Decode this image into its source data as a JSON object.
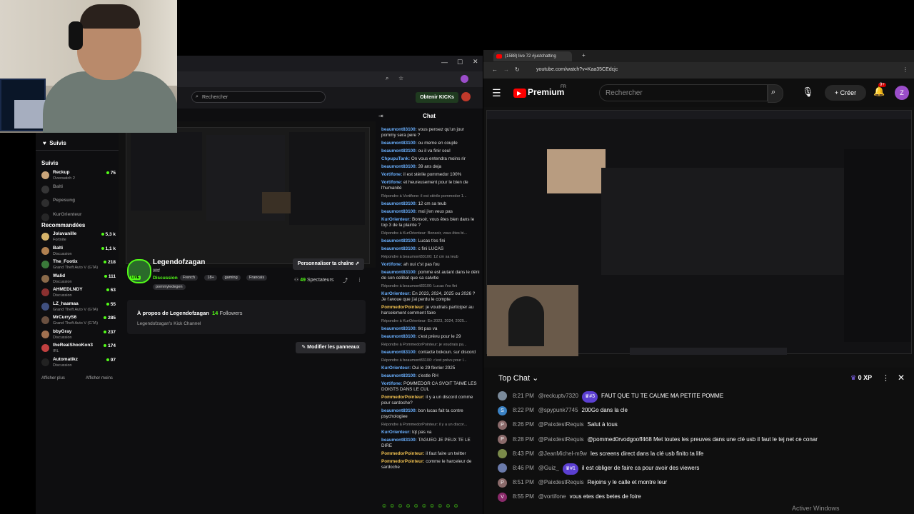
{
  "kick": {
    "search_placeholder": "Rechercher",
    "get_kicks": "Obtenir KICKs",
    "chat_title": "Chat",
    "sidebar": {
      "follows_header": "Suivis",
      "follows_label": "Suivis",
      "followed": [
        {
          "name": "Reckup",
          "game": "Overwatch 2",
          "count": "75",
          "color": "#c9a57a"
        },
        {
          "name": "Balti",
          "game": "",
          "count": "",
          "color": "#666"
        },
        {
          "name": "Pepesung",
          "game": "",
          "count": "",
          "color": "#555"
        },
        {
          "name": "KurOrienteur",
          "game": "",
          "count": "",
          "color": "#444"
        }
      ],
      "recommended_header": "Recommandées",
      "recommended": [
        {
          "name": "Jolavanille",
          "game": "Fortnite",
          "count": "5,3 k",
          "color": "#d6b36a"
        },
        {
          "name": "Balti",
          "game": "Discussion",
          "count": "1,1 k",
          "color": "#b08050"
        },
        {
          "name": "The_Footix",
          "game": "Grand Theft Auto V (GTA)",
          "count": "218",
          "color": "#3a7a3a"
        },
        {
          "name": "Walid",
          "game": "Discussion",
          "count": "111",
          "color": "#8a6a4a"
        },
        {
          "name": "AHMEDLNDY",
          "game": "Discussion",
          "count": "63",
          "color": "#8a3030"
        },
        {
          "name": "LZ_haamaa",
          "game": "Grand Theft Auto V (GTA)",
          "count": "55",
          "color": "#405080"
        },
        {
          "name": "MrCurryS6",
          "game": "Grand Theft Auto V (GTA)",
          "count": "285",
          "color": "#6a5040"
        },
        {
          "name": "bbyGray",
          "game": "Discussion",
          "count": "237",
          "color": "#a07050"
        },
        {
          "name": "theRealShooKon3",
          "game": "IRL",
          "count": "174",
          "color": "#c04040"
        },
        {
          "name": "Automatikz",
          "game": "Discussion",
          "count": "97",
          "color": "#222"
        }
      ],
      "show_more": "Afficher plus",
      "show_less": "Afficher moins"
    },
    "channel": {
      "name": "Legendofzagan",
      "subtitle": "Wtf",
      "category": "Discussion",
      "tags": [
        "French",
        "18+",
        "gaming",
        "Francais",
        "pommyledegen"
      ],
      "live": "LIVE",
      "customize": "Personnaliser ta chaîne",
      "viewers": "49",
      "viewers_label": "Spectateurs",
      "about": "À propos de Legendofzagan",
      "followers": "14",
      "followers_label": "Followers",
      "about_text": "Legendofzagan's Kick Channel",
      "edit_panels": "Modifier les panneaux"
    },
    "chat": [
      {
        "user": "beaumont83100:",
        "msg": "vous pensez qu'un jour pommy sera pere ?"
      },
      {
        "user": "beaumont83100:",
        "msg": "ou meme en couple"
      },
      {
        "user": "beaumont83100:",
        "msg": "ou il va finir seul"
      },
      {
        "user": "ChpupuTank:",
        "msg": "On vous entendra moins rir"
      },
      {
        "user": "beaumont83100:",
        "msg": "39 ans deja"
      },
      {
        "user": "Vortifone:",
        "msg": "il est stérile pommedor 100%"
      },
      {
        "user": "Vortifone:",
        "msg": "et heureusement pour le bien de l'humanité"
      },
      {
        "reply": "Répondre à Vortifone: il est stérile pommedor 1..."
      },
      {
        "user": "beaumont83100:",
        "msg": "12 cm sa teub"
      },
      {
        "user": "beaumont83100:",
        "msg": "moi j'en veux pas"
      },
      {
        "user": "KurOrienteur:",
        "msg": "Bonsoir, vous êtes bien dans le top 3 de la plainte ?"
      },
      {
        "reply": "Répondre à KurOrienteur: Bonsoir, vous êtes bi..."
      },
      {
        "user": "beaumont83100:",
        "msg": "Lucas t'es fini"
      },
      {
        "user": "beaumont83100:",
        "msg": "c fini LUCAS"
      },
      {
        "reply": "Répondre à beaumont83100: 12 cm sa teub"
      },
      {
        "user": "Vortifone:",
        "msg": "ah oui c'st pas fou"
      },
      {
        "user": "beaumont83100:",
        "msg": "pomme est autant dans le déni de son celibat que sa calvitie"
      },
      {
        "reply": "Répondre à beaumont83100: Lucas t'es fini"
      },
      {
        "user": "KurOrienteur:",
        "msg": "En 2023, 2024, 2025 ou 2026 ? Je t'avoue que j'ai perdu le compte"
      },
      {
        "user": "PommedorPointeur:",
        "msg": "je voudrais participer au harcelement comment faire",
        "y": true
      },
      {
        "reply": "Répondre à KurOrienteur: En 2023, 2024, 2025..."
      },
      {
        "user": "beaumont83100:",
        "msg": "tkt pas va"
      },
      {
        "user": "beaumont83100:",
        "msg": "c'est prévu pour le 29"
      },
      {
        "reply": "Répondre à PommedorPointeur: je voudrais pa..."
      },
      {
        "user": "beaumont83100:",
        "msg": "contacte bokoun. sur discord"
      },
      {
        "reply": "Répondre à beaumont83100: c'est prévu pour l..."
      },
      {
        "user": "KurOrienteur:",
        "msg": "Oui le 29 février 2025"
      },
      {
        "user": "beaumont83100:",
        "msg": "c'estle RH"
      },
      {
        "user": "Vortifone:",
        "msg": "POMMEDOR CA SVOIT TAIME LES DOIGTS DANS LE CUL"
      },
      {
        "user": "PommedorPointeur:",
        "msg": "il y a un discord comme pour sardoche?",
        "y": true
      },
      {
        "user": "beaumont83100:",
        "msg": "bon lucas fait ta contre psychologiee"
      },
      {
        "reply": "Répondre à PommedorPointeur: il y a un discor..."
      },
      {
        "user": "KurOrienteur:",
        "msg": "tqt pas va"
      },
      {
        "user": "beaumont83100:",
        "msg": "TAGUEO JE PEUX TE LE DIRE"
      },
      {
        "user": "PommedorPointeur:",
        "msg": "il faut faire un twitter",
        "y": true
      },
      {
        "user": "PommedorPointeur:",
        "msg": "comme le harceleur de sardoche",
        "y": true
      }
    ]
  },
  "youtube": {
    "tab_title": "(1588) live 72 #justchatting",
    "url": "youtube.com/watch?v=Kaa35CEdcjc",
    "premium": "Premium",
    "premium_region": "FR",
    "search_placeholder": "Rechercher",
    "create": "Créer",
    "notif_count": "9+",
    "avatar_letter": "Z",
    "top_chat": "Top Chat",
    "xp": "0 XP",
    "watermark": "Activer Windows",
    "messages": [
      {
        "time": "8:21 PM",
        "user": "@reckuptv7320",
        "badge": "#3",
        "msg": "FAUT QUE TU TE CALME MA PETITE POMME",
        "color": "#7a8a9a",
        "letter": ""
      },
      {
        "time": "8:22 PM",
        "user": "@spypunk7745",
        "badge": "",
        "msg": "200Go dans la cle",
        "color": "#3b82c4",
        "letter": "S"
      },
      {
        "time": "8:26 PM",
        "user": "@PaixdestRequis",
        "badge": "",
        "msg": "Salut à tous",
        "color": "#8a6a6a",
        "letter": "P"
      },
      {
        "time": "8:28 PM",
        "user": "@PaixdestRequis",
        "badge": "",
        "msg": "@pommed0rvodgooff468 Met toutes les preuves dans une clé usb il faut le tej net ce conar",
        "color": "#8a6a6a",
        "letter": "P"
      },
      {
        "time": "8:43 PM",
        "user": "@JeanMichel-m9w",
        "badge": "",
        "msg": "les screens direct dans la clé usb finito ta life",
        "color": "#7a8a4a",
        "letter": ""
      },
      {
        "time": "8:46 PM",
        "user": "@Guiz_",
        "badge": "#1",
        "msg": "il est obliger de faire ca pour avoir des viewers",
        "color": "#6a7aaa",
        "letter": ""
      },
      {
        "time": "8:51 PM",
        "user": "@PaixdestRequis",
        "badge": "",
        "msg": "Rejoins y le calle et montre leur",
        "color": "#8a6a6a",
        "letter": "P"
      },
      {
        "time": "8:55 PM",
        "user": "@vortifone",
        "badge": "",
        "msg": "vous etes des betes de foire",
        "color": "#8a2a6a",
        "letter": "V"
      }
    ]
  },
  "colors": {
    "kick_green": "#53fc18",
    "yt_red": "#ff0000",
    "badge_purple": "#5b3fd1"
  }
}
